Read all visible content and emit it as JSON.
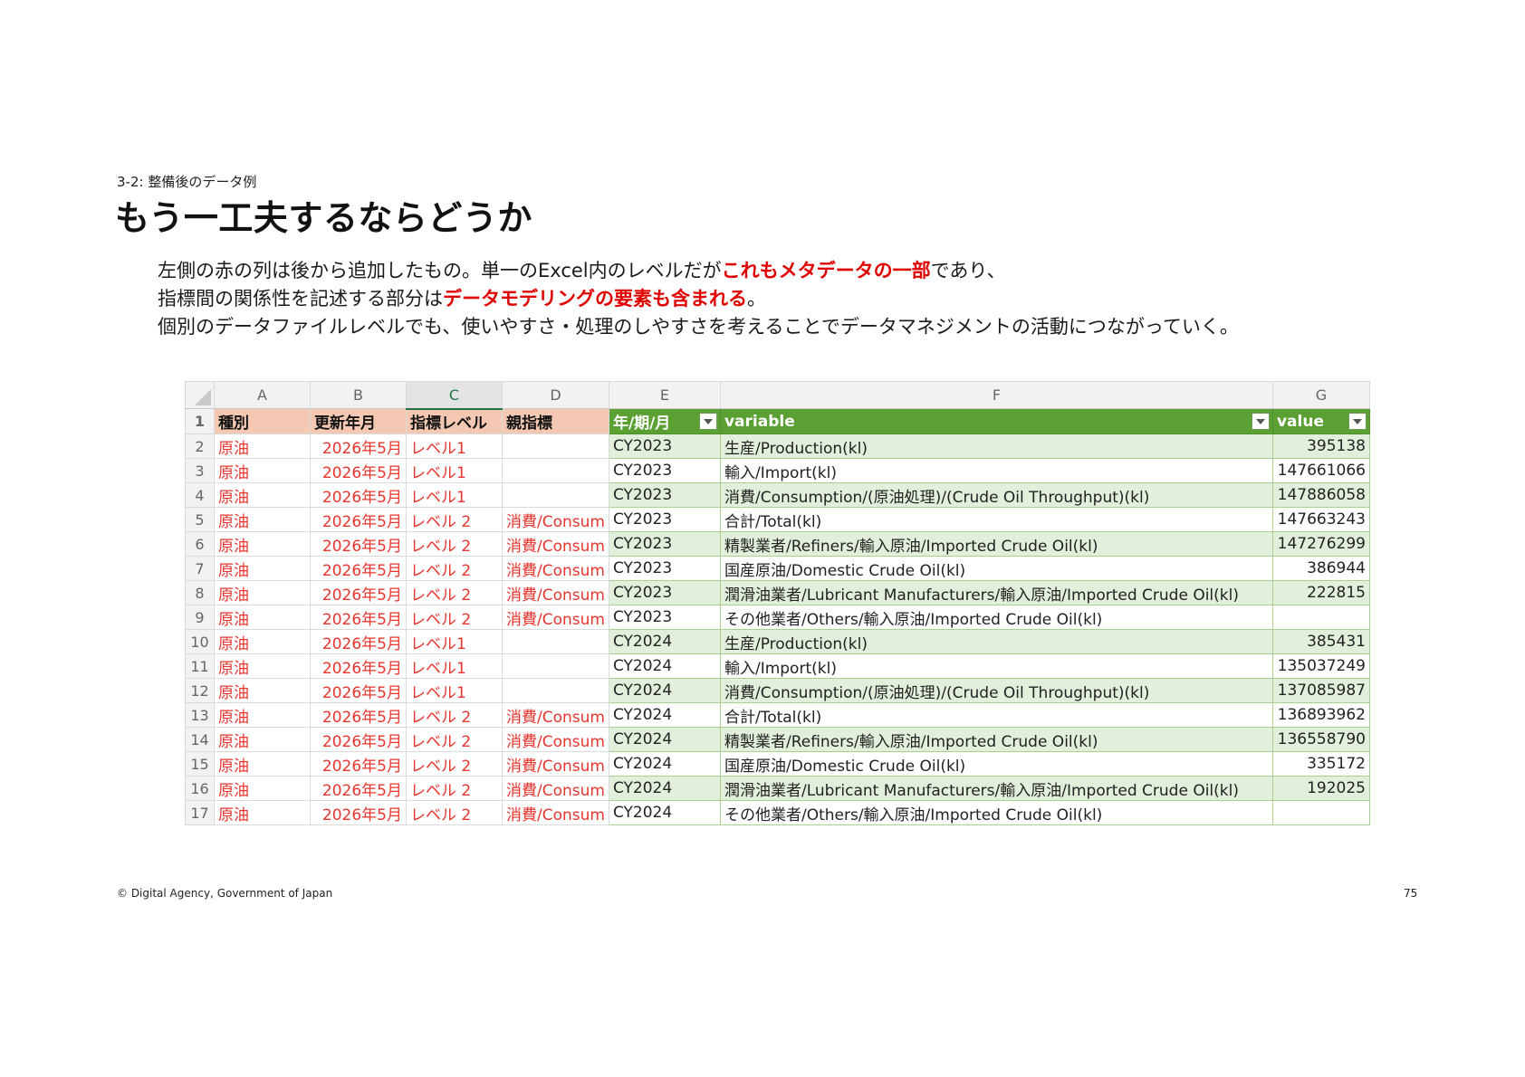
{
  "header": {
    "section_label": "3-2: 整備後のデータ例",
    "title": "もう一工夫するならどうか"
  },
  "body": {
    "line1_a": "左側の赤の列は後から追加したもの。単一のExcel内のレベルだが",
    "line1_hl": "これもメタデータの一部",
    "line1_b": "であり、",
    "line2_a": "指標間の関係性を記述する部分は",
    "line2_hl": "データモデリングの要素も含まれる",
    "line2_b": "。",
    "line3": "個別のデータファイルレベルでも、使いやすさ・処理のしやすさを考えることでデータマネジメントの活動につながっていく。"
  },
  "spreadsheet": {
    "column_letters": [
      "A",
      "B",
      "C",
      "D",
      "E",
      "F",
      "G"
    ],
    "selected_column": "C",
    "header_row_number": "1",
    "headers": [
      "種別",
      "更新年月",
      "指標レベル",
      "親指標",
      "年/期/月",
      "variable",
      "value"
    ],
    "rows": [
      {
        "n": "2",
        "a": "原油",
        "b": "2026年5月",
        "c": "レベル1",
        "d": "",
        "e": "CY2023",
        "f": "生産/Production(kl)",
        "g": "395138"
      },
      {
        "n": "3",
        "a": "原油",
        "b": "2026年5月",
        "c": "レベル1",
        "d": "",
        "e": "CY2023",
        "f": "輸入/Import(kl)",
        "g": "147661066"
      },
      {
        "n": "4",
        "a": "原油",
        "b": "2026年5月",
        "c": "レベル1",
        "d": "",
        "e": "CY2023",
        "f": "消費/Consumption/(原油処理)/(Crude Oil Throughput)(kl)",
        "g": "147886058"
      },
      {
        "n": "5",
        "a": "原油",
        "b": "2026年5月",
        "c": "レベル 2",
        "d": "消費/Consum",
        "e": "CY2023",
        "f": "合計/Total(kl)",
        "g": "147663243"
      },
      {
        "n": "6",
        "a": "原油",
        "b": "2026年5月",
        "c": "レベル 2",
        "d": "消費/Consum",
        "e": "CY2023",
        "f": "精製業者/Refiners/輸入原油/Imported Crude Oil(kl)",
        "g": "147276299"
      },
      {
        "n": "7",
        "a": "原油",
        "b": "2026年5月",
        "c": "レベル 2",
        "d": "消費/Consum",
        "e": "CY2023",
        "f": "国産原油/Domestic Crude Oil(kl)",
        "g": "386944"
      },
      {
        "n": "8",
        "a": "原油",
        "b": "2026年5月",
        "c": "レベル 2",
        "d": "消費/Consum",
        "e": "CY2023",
        "f": "潤滑油業者/Lubricant Manufacturers/輸入原油/Imported Crude Oil(kl)",
        "g": "222815"
      },
      {
        "n": "9",
        "a": "原油",
        "b": "2026年5月",
        "c": "レベル 2",
        "d": "消費/Consum",
        "e": "CY2023",
        "f": "その他業者/Others/輸入原油/Imported Crude Oil(kl)",
        "g": ""
      },
      {
        "n": "10",
        "a": "原油",
        "b": "2026年5月",
        "c": "レベル1",
        "d": "",
        "e": "CY2024",
        "f": "生産/Production(kl)",
        "g": "385431"
      },
      {
        "n": "11",
        "a": "原油",
        "b": "2026年5月",
        "c": "レベル1",
        "d": "",
        "e": "CY2024",
        "f": "輸入/Import(kl)",
        "g": "135037249"
      },
      {
        "n": "12",
        "a": "原油",
        "b": "2026年5月",
        "c": "レベル1",
        "d": "",
        "e": "CY2024",
        "f": "消費/Consumption/(原油処理)/(Crude Oil Throughput)(kl)",
        "g": "137085987"
      },
      {
        "n": "13",
        "a": "原油",
        "b": "2026年5月",
        "c": "レベル 2",
        "d": "消費/Consum",
        "e": "CY2024",
        "f": "合計/Total(kl)",
        "g": "136893962"
      },
      {
        "n": "14",
        "a": "原油",
        "b": "2026年5月",
        "c": "レベル 2",
        "d": "消費/Consum",
        "e": "CY2024",
        "f": "精製業者/Refiners/輸入原油/Imported Crude Oil(kl)",
        "g": "136558790"
      },
      {
        "n": "15",
        "a": "原油",
        "b": "2026年5月",
        "c": "レベル 2",
        "d": "消費/Consum",
        "e": "CY2024",
        "f": "国産原油/Domestic Crude Oil(kl)",
        "g": "335172"
      },
      {
        "n": "16",
        "a": "原油",
        "b": "2026年5月",
        "c": "レベル 2",
        "d": "消費/Consum",
        "e": "CY2024",
        "f": "潤滑油業者/Lubricant Manufacturers/輸入原油/Imported Crude Oil(kl)",
        "g": "192025"
      },
      {
        "n": "17",
        "a": "原油",
        "b": "2026年5月",
        "c": "レベル 2",
        "d": "消費/Consum",
        "e": "CY2024",
        "f": "その他業者/Others/輸入原油/Imported Crude Oil(kl)",
        "g": ""
      }
    ]
  },
  "footer": {
    "copyright": "© Digital Agency, Government of Japan",
    "page_number": "75"
  },
  "colors": {
    "highlight_red": "#e00000",
    "added_column_text": "#e8352e",
    "pink_header": "#f4c8b2",
    "green_header": "#5aa033",
    "green_band": "#e2efda"
  }
}
